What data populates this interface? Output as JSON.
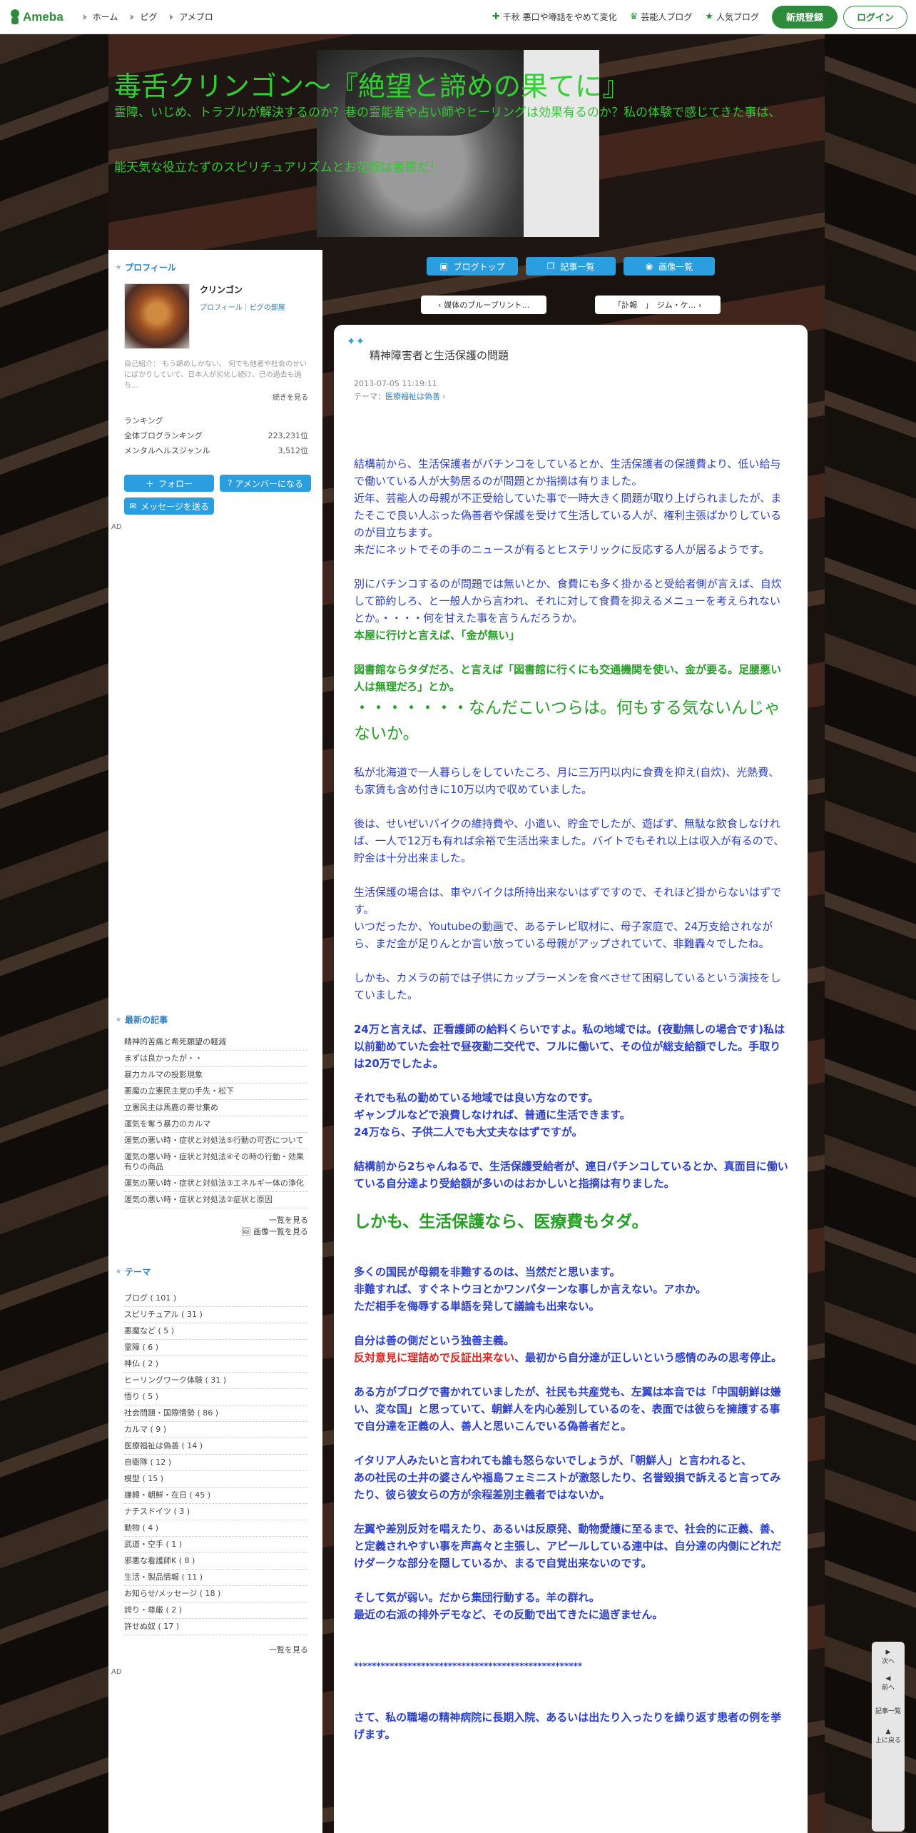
{
  "topbar": {
    "logo": "Ameba",
    "nav": [
      "ホーム",
      "ピグ",
      "アメブロ"
    ],
    "links": [
      "千秋 悪口や噂話をやめて変化",
      "芸能人ブログ",
      "人気ブログ"
    ],
    "signup": "新規登録",
    "login": "ログイン"
  },
  "header": {
    "title": "毒舌クリンゴン～『絶望と諦めの果てに』",
    "desc1": "霊障、いじめ、トラブルが解決するのか？巷の霊能者や占い師やヒーリングは効果有るのか？私の体験で感じてきた事は、",
    "desc2": "能天気な役立たずのスピリチュアリズムとお花畑は害悪だ！"
  },
  "sidebar": {
    "profile_head": "プロフィール",
    "name": "クリンゴン",
    "links": "プロフィール｜ピグの部屋",
    "bio": "自己紹介： もう諦めしかない。 何でも他者や社会のせいにばかりしていて、日本人が劣化し続け、己の過去も過ち...",
    "more": "続きを見る",
    "rank_title": "ランキング",
    "rank1_label": "全体ブログランキング",
    "rank1_value": "223,231位",
    "rank2_label": "メンタルヘルスジャンル",
    "rank2_value": "3,512位",
    "follow": "フォロー",
    "amember": "アメンバーになる",
    "message": "メッセージを送る",
    "ad": "AD",
    "recent_head": "最新の記事",
    "recent": [
      "精神的苦痛と希死願望の軽減",
      "まずは良かったが・・",
      "暴力カルマの投影現象",
      "悪魔の立憲民主党の手先・松下",
      "立憲民主は馬鹿の寄せ集め",
      "運気を奪う暴力のカルマ",
      "運気の悪い時・症状と対処法⑤行動の可否について",
      "運気の悪い時・症状と対処法④その時の行動・効果有りの商品",
      "運気の悪い時・症状と対処法③エネルギー体の浄化",
      "運気の悪い時・症状と対処法②症状と原因"
    ],
    "recent_more": "一覧を見る",
    "image_more": "画像一覧を見る",
    "theme_head": "テーマ",
    "themes": [
      "ブログ ( 101 )",
      "スピリチュアル ( 31 )",
      "悪魔など ( 5 )",
      "霊障 ( 6 )",
      "神仏 ( 2 )",
      "ヒーリングワーク体験 ( 31 )",
      "悟り ( 5 )",
      "社会問題・国際情勢 ( 86 )",
      "カルマ ( 9 )",
      "医療福祉は偽善 ( 14 )",
      "自衛隊 ( 12 )",
      "模型 ( 15 )",
      "嫌韓・朝鮮・在日 ( 45 )",
      "ナチスドイツ ( 3 )",
      "動物 ( 4 )",
      "武道・空手 ( 1 )",
      "邪悪な看護師K ( 8 )",
      "生活・製品情報 ( 11 )",
      "お知らせ/メッセージ ( 18 )",
      "誇り・尊厳 ( 2 )",
      "許せぬ奴 ( 17 )"
    ],
    "theme_more": "一覧を見る",
    "ad2": "AD"
  },
  "nav": {
    "top": "ブログトップ",
    "list": "記事一覧",
    "images": "画像一覧",
    "prev": "媒体のブループリント...",
    "next": "「訃報　」　ジム・ケ..."
  },
  "article": {
    "title": "精神障害者と生活保護の問題",
    "date": "2013-07-05 11:19:11",
    "theme_label": "テーマ：",
    "theme": "医療福祉は偽善",
    "p1": "結構前から、生活保護者がパチンコをしているとか、生活保護者の保護費より、低い給与で働いている人が大勢居るのが問題とか指摘は有りました。",
    "p2": "近年、芸能人の母親が不正受給していた事で一時大きく問題が取り上げられましたが、またそこで良い人ぶった偽善者や保護を受けて生活している人が、権利主張ばかりしているのが目立ちます。",
    "p3": "未だにネットでその手のニュースが有るとヒステリックに反応する人が居るようです。",
    "p4": "別にパチンコするのが問題では無いとか、食費にも多く掛かると受給者側が言えば、自炊して節約しろ、と一般人から言われ、それに対して食費を抑えるメニューを考えられないとか。・・・・何を甘えた事を言うんだろうか。",
    "p5": "本屋に行けと言えば、「金が無い」",
    "p6": "図書館ならタダだろ、と言えば「図書館に行くにも交通機関を使い、金が要る。足腰悪い人は無理だろ」とか。",
    "p7": "・・・・・・・なんだこいつらは。何もする気ないんじゃないか。",
    "p8": "私が北海道で一人暮らしをしていたころ、月に三万円以内に食費を抑え(自炊)、光熱費、も家賃も含め付きに10万以内で収めていました。",
    "p9": "後は、せいぜいバイクの維持費や、小遣い、貯金でしたが、遊ばず、無駄な飲食しなければ、一人で12万も有れば余裕で生活出来ました。バイトでもそれ以上は収入が有るので、貯金は十分出来ました。",
    "p10": "生活保護の場合は、車やバイクは所持出来ないはずですので、それほど掛からないはずです。",
    "p11": "いつだったか、Youtubeの動画で、あるテレビ取材に、母子家庭で、24万支給されながら、まだ金が足りんとか言い放っている母親がアップされていて、非難轟々でしたね。",
    "p12": "しかも、カメラの前では子供にカップラーメンを食べさせて困窮しているという演技をしていました。",
    "p13": "24万と言えば、正看護師の給料くらいですよ。私の地域では。(夜勤無しの場合です)私は以前勤めていた会社で昼夜勤二交代で、フルに働いて、その位が総支給額でした。手取りは20万でしたよ。",
    "p14": "それでも私の勤めている地域では良い方なのです。",
    "p15": "ギャンブルなどで浪費しなければ、普通に生活できます。",
    "p16": "24万なら、子供二人でも大丈夫なはずですが。",
    "p17": "結構前から2ちゃんねるで、生活保護受給者が、連日パチンコしているとか、真面目に働いている自分達より受給額が多いのはおかしいと指摘は有りました。",
    "p18": "しかも、生活保護なら、医療費もタダ。",
    "p19": "多くの国民が母親を非難するのは、当然だと思います。",
    "p20": "非難すれば、すぐネトウヨとかワンパターンな事しか言えない。アホか。",
    "p21": "ただ相手を侮辱する単語を発して議論も出来ない。",
    "p22": "自分は善の側だという独善主義。",
    "p23_red": "反対意見に理詰めで反証出来ない",
    "p23_rest": "、最初から自分達が正しいという感情のみの思考停止。",
    "p24": "ある方がブログで書かれていましたが、社民も共産党も、左翼は本音では「中国朝鮮は嫌い、変な国」と思っていて、朝鮮人を内心差別しているのを、表面では彼らを擁護する事で自分達を正義の人、善人と思いこんでいる偽善者だと。",
    "p25": "イタリア人みたいと言われても誰も怒らないでしょうが、「朝鮮人」と言われると、",
    "p26": "あの社民の土井の婆さんや福島フェミニストが激怒したり、名誉毀損で訴えると言ってみたり、彼ら彼女らの方が余程差別主義者ではないか。",
    "p27": "左翼や差別反対を唱えたり、あるいは反原発、動物愛護に至るまで、社会的に正義、善、と定義されやすい事を声高々と主張し、アピールしている連中は、自分達の内側にどれだけダークな部分を隠しているか、まるで自覚出来ないのです。",
    "p28": "そして気が弱い。だから集団行動する。羊の群れ。",
    "p29": "最近の右派の排外デモなど、その反動で出てきたに過ぎません。",
    "p30": "***************************************************",
    "p31": "さて、私の職場の精神病院に長期入院、あるいは出たり入ったりを繰り返す患者の例を挙げます。"
  },
  "float": {
    "next": "次へ",
    "prev": "前へ",
    "list": "記事一覧",
    "top": "上に戻る"
  }
}
